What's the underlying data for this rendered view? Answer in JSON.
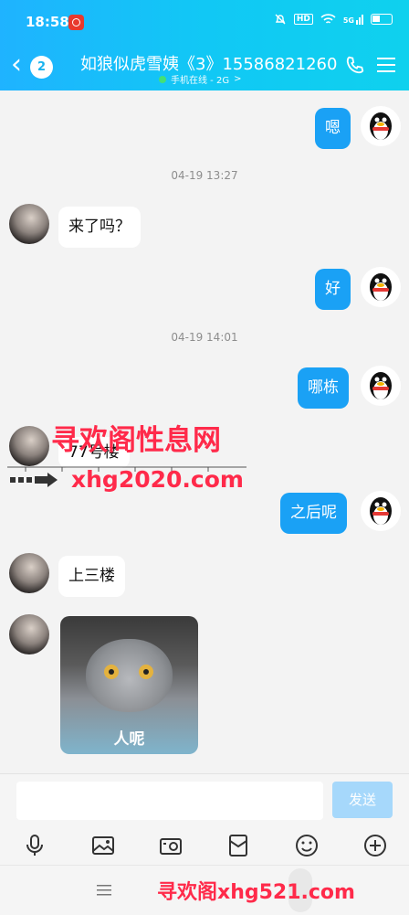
{
  "status": {
    "time": "18:58",
    "net_label": "HD",
    "signal_label": "5G"
  },
  "header": {
    "back_count": "2",
    "title": "如狼似虎雪姨《3》15586821260",
    "subtitle": "手机在线 - 2G",
    "subtitle_arrow": ">"
  },
  "messages": [
    {
      "side": "me",
      "text": "嗯"
    },
    {
      "side": "time",
      "text": "04-19 13:27"
    },
    {
      "side": "them",
      "text": "来了吗？"
    },
    {
      "side": "me",
      "text": "好"
    },
    {
      "side": "time",
      "text": "04-19 14:01"
    },
    {
      "side": "me",
      "text": "哪栋"
    },
    {
      "side": "them",
      "text": "77号楼"
    },
    {
      "side": "me",
      "text": "之后呢"
    },
    {
      "side": "them",
      "text": "上三楼"
    },
    {
      "side": "them",
      "sticker_caption": "人呢"
    }
  ],
  "watermarks": {
    "top": "寻欢阁性息网",
    "middle": "xhg2020.com",
    "bottom": "寻欢阁xhg521.com"
  },
  "input": {
    "placeholder": "",
    "send_label": "发送"
  },
  "tools": [
    "microphone-icon",
    "image-icon",
    "camera-icon",
    "red-packet-icon",
    "emoji-icon",
    "plus-icon"
  ],
  "colors": {
    "accent": "#1aa1f5",
    "header": "#13c0f2",
    "watermark": "#ff2a4a"
  }
}
